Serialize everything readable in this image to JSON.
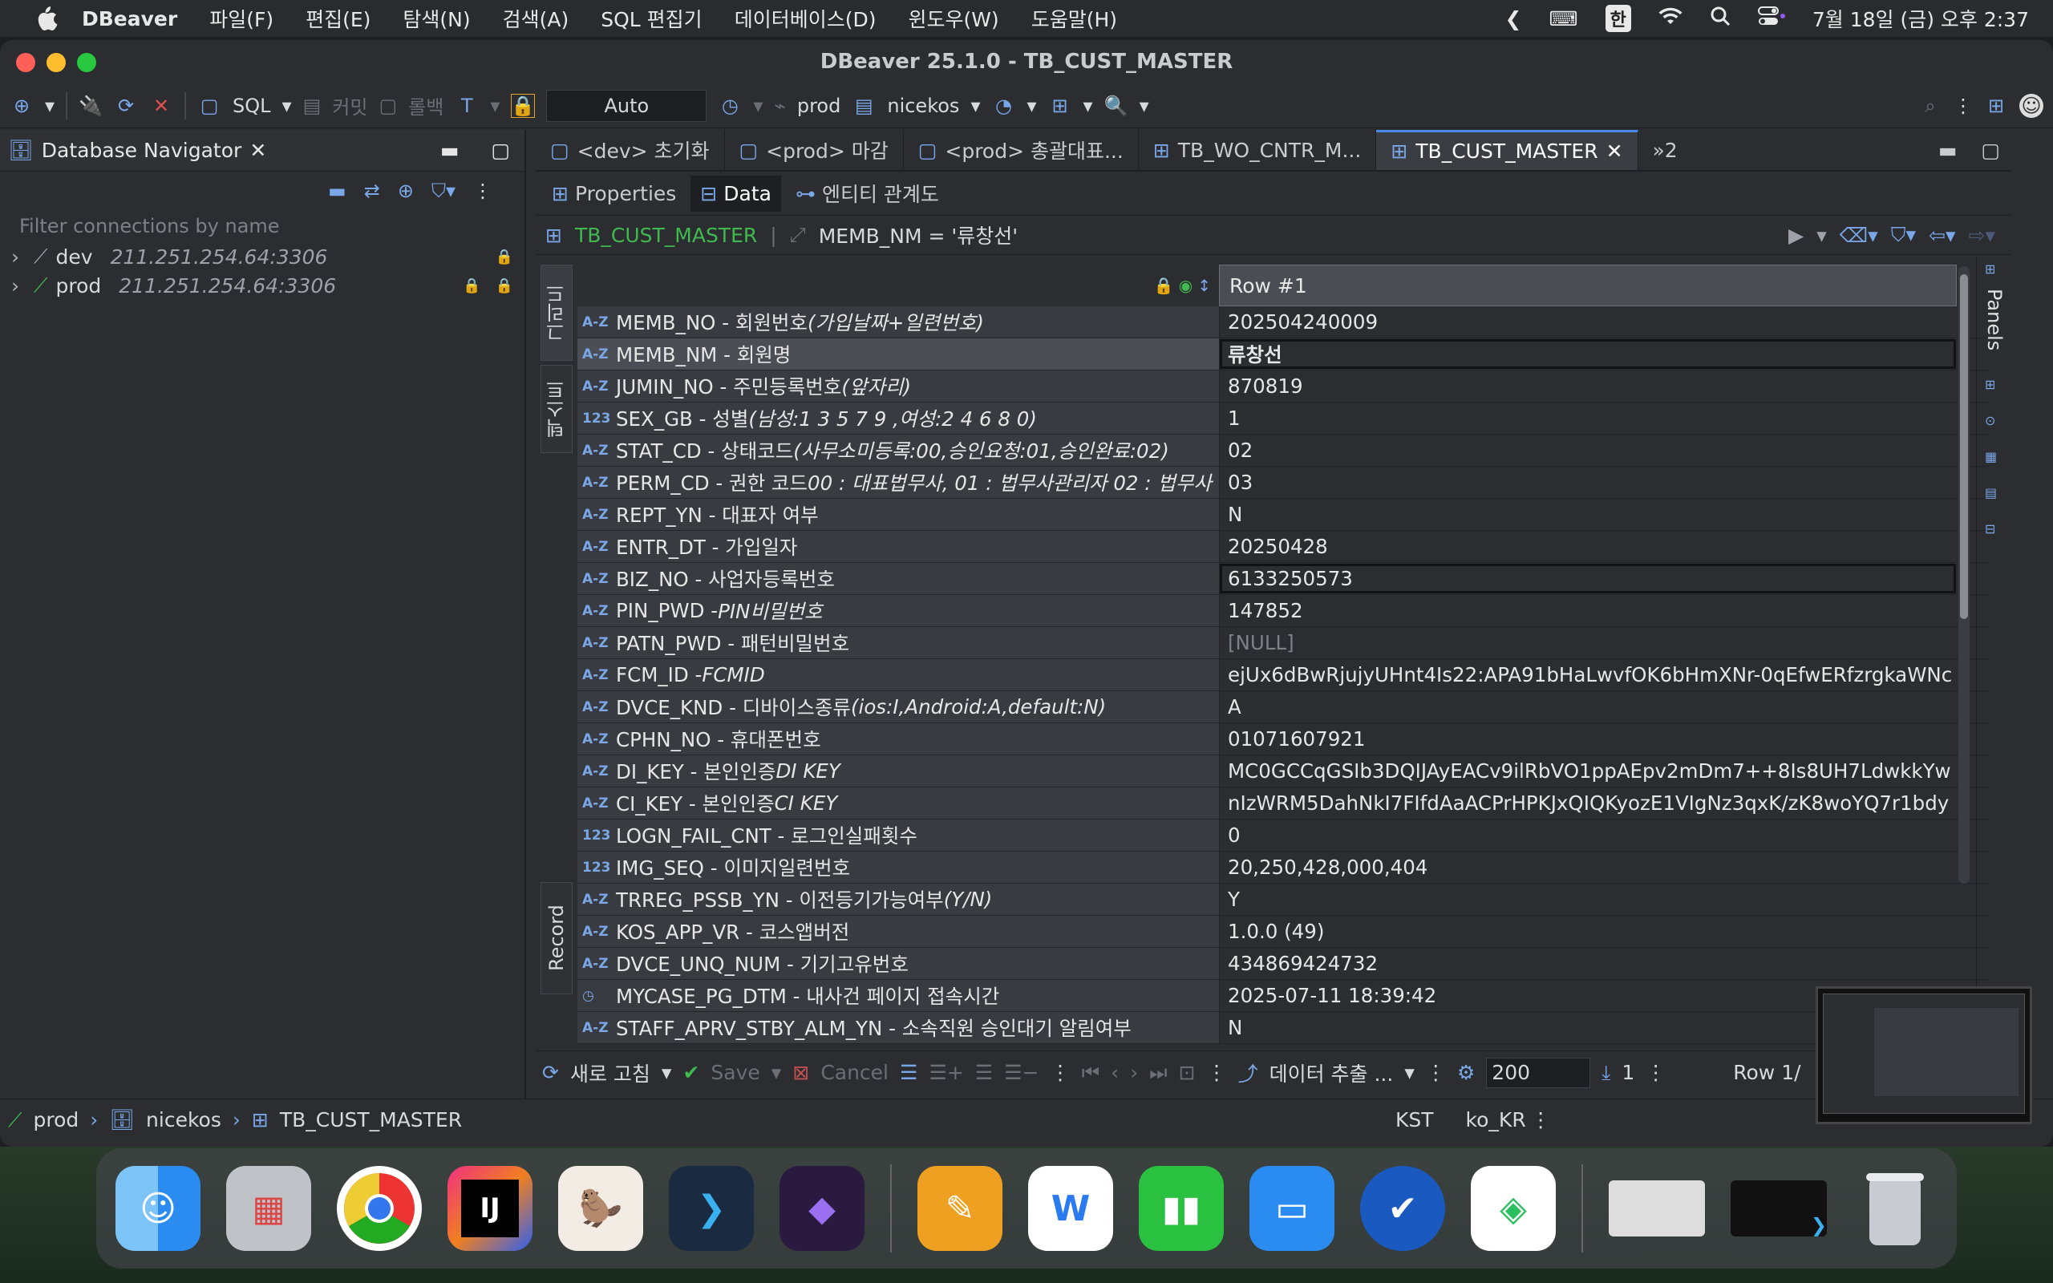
{
  "menubar": {
    "app": "DBeaver",
    "items": [
      "파일(F)",
      "편집(E)",
      "탐색(N)",
      "검색(A)",
      "SQL 편집기",
      "데이터베이스(D)",
      "윈도우(W)",
      "도움말(H)"
    ],
    "input_source": "한",
    "clock": "7월 18일 (금) 오후 2:37"
  },
  "window": {
    "title": "DBeaver 25.1.0 - TB_CUST_MASTER"
  },
  "toolbar": {
    "sql": "SQL",
    "commit": "커밋",
    "rollback": "롤백",
    "tx_mode": "Auto",
    "connection": "prod",
    "schema": "nicekos"
  },
  "navigator": {
    "title": "Database Navigator",
    "filter_placeholder": "Filter connections by name",
    "connections": [
      {
        "name": "dev",
        "host": "211.251.254.64:3306"
      },
      {
        "name": "prod",
        "host": "211.251.254.64:3306"
      }
    ]
  },
  "editor": {
    "tabs": [
      "<dev> 초기화",
      "<prod> 마감",
      "<prod> 총괄대표...",
      "TB_WO_CNTR_M...",
      "TB_CUST_MASTER"
    ],
    "tab_overflow": "»2",
    "subtabs": [
      "Properties",
      "Data",
      "엔티티 관계도"
    ],
    "filter_table": "TB_CUST_MASTER",
    "filter_expr": "MEMB_NM = '류창선'"
  },
  "grid": {
    "vtab_grid": "그리드",
    "vtab_text": "텍스트",
    "vtab_record": "Record",
    "header": "Row  #1",
    "rows": [
      {
        "t": "A-Z",
        "name": "MEMB_NO - 회원번호",
        "note": "(가입날짜+일련번호)",
        "value": "202504240009"
      },
      {
        "t": "A-Z",
        "name": "MEMB_NM - 회원명",
        "note": "",
        "value": "류창선"
      },
      {
        "t": "A-Z",
        "name": "JUMIN_NO - 주민등록번호",
        "note": "(앞자리)",
        "value": "870819"
      },
      {
        "t": "123",
        "name": "SEX_GB - 성별",
        "note": "(남성:1 3 5 7 9 ,여성:2 4 6 8 0)",
        "value": "1"
      },
      {
        "t": "A-Z",
        "name": "STAT_CD - 상태코드",
        "note": "(사무소미등록:00,승인요청:01,승인완료:02)",
        "value": "02"
      },
      {
        "t": "A-Z",
        "name": "PERM_CD - 권한 코드 ",
        "note": "00 : 대표법무사, 01 : 법무사관리자 02 : 법무사",
        "value": "03"
      },
      {
        "t": "A-Z",
        "name": "REPT_YN - 대표자 여부",
        "note": "",
        "value": "N"
      },
      {
        "t": "A-Z",
        "name": "ENTR_DT - 가입일자",
        "note": "",
        "value": "20250428"
      },
      {
        "t": "A-Z",
        "name": "BIZ_NO - 사업자등록번호",
        "note": "",
        "value": "6133250573"
      },
      {
        "t": "A-Z",
        "name": "PIN_PWD - ",
        "note": "PIN비밀번호",
        "value": "147852"
      },
      {
        "t": "A-Z",
        "name": "PATN_PWD - 패턴비밀번호",
        "note": "",
        "value": "[NULL]"
      },
      {
        "t": "A-Z",
        "name": "FCM_ID - ",
        "note": "FCMID",
        "value": "ejUx6dBwRjujyUHnt4Is22:APA91bHaLwvfOK6bHmXNr-0qEfwERfzrgkaWNc"
      },
      {
        "t": "A-Z",
        "name": "DVCE_KND - 디바이스종류",
        "note": "(ios:I,Android:A,default:N)",
        "value": "A"
      },
      {
        "t": "A-Z",
        "name": "CPHN_NO - 휴대폰번호",
        "note": "",
        "value": "01071607921"
      },
      {
        "t": "A-Z",
        "name": "DI_KEY - 본인인증 ",
        "note": "DI KEY",
        "value": "MC0GCCqGSIb3DQIJAyEACv9ilRbVO1ppAEpv2mDm7++8Is8UH7LdwkkYw"
      },
      {
        "t": "A-Z",
        "name": "CI_KEY - 본인인증 ",
        "note": "CI KEY",
        "value": "nIzWRM5DahNkI7FIfdAaACPrHPKJxQIQKyozE1VIgNz3qxK/zK8woYQ7r1bdy"
      },
      {
        "t": "123",
        "name": "LOGN_FAIL_CNT - 로그인실패횟수",
        "note": "",
        "value": "0"
      },
      {
        "t": "123",
        "name": "IMG_SEQ - 이미지일련번호",
        "note": "",
        "value": "20,250,428,000,404"
      },
      {
        "t": "A-Z",
        "name": "TRREG_PSSB_YN - 이전등기가능여부",
        "note": "(Y/N)",
        "value": "Y"
      },
      {
        "t": "A-Z",
        "name": "KOS_APP_VR - 코스앱버전",
        "note": "",
        "value": "1.0.0 (49)"
      },
      {
        "t": "A-Z",
        "name": "DVCE_UNQ_NUM - 기기고유번호",
        "note": "",
        "value": "434869424732"
      },
      {
        "t": "clock",
        "name": "MYCASE_PG_DTM - 내사건 페이지 접속시간",
        "note": "",
        "value": "2025-07-11 18:39:42"
      },
      {
        "t": "A-Z",
        "name": "STAFF_APRV_STBY_ALM_YN - 소속직원 승인대기 알림여부",
        "note": "",
        "value": "N"
      }
    ]
  },
  "panels_label": "Panels",
  "bottombar": {
    "refresh": "새로 고침",
    "save": "Save",
    "cancel": "Cancel",
    "export": "데이터 추출 ...",
    "fetch_size": "200",
    "row_count": "1",
    "row_pos": "Row 1/"
  },
  "statusbar": {
    "conn": "prod",
    "schema": "nicekos",
    "table": "TB_CUST_MASTER",
    "tz": "KST",
    "locale": "ko_KR"
  },
  "dock": {
    "icons": [
      "finder-icon",
      "launchpad-icon",
      "chrome-icon",
      "intellij-icon",
      "dbeaver-icon",
      "terminal-app-icon",
      "obsidian-icon",
      "pages-icon",
      "naver-works-icon",
      "numbers-icon",
      "keynote-icon",
      "sync-icon",
      "naver-box-icon",
      "window-preview-icon",
      "terminal-preview-icon",
      "trash-icon"
    ]
  },
  "colors": {
    "accent": "#4a88e8",
    "table_green": "#3fb950",
    "bg": "#2b2d30"
  }
}
